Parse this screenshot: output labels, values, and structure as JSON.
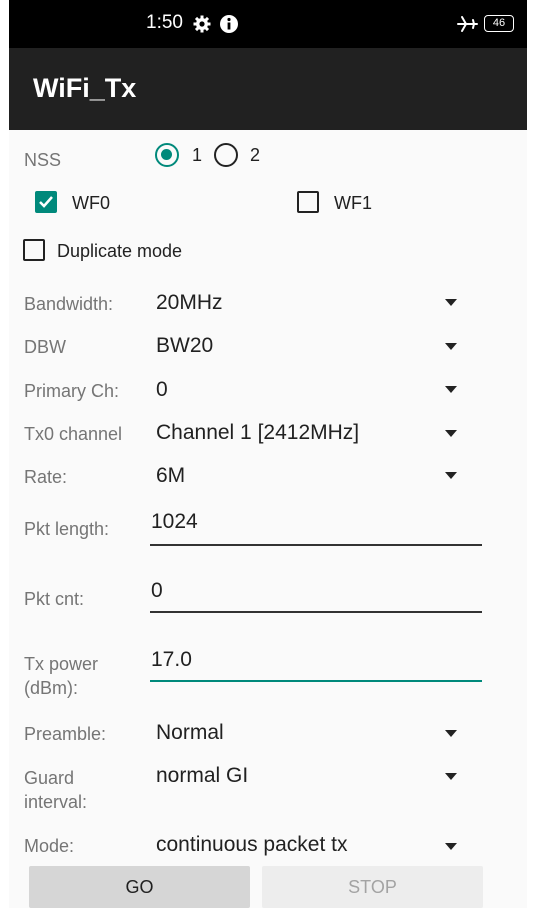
{
  "status": {
    "time": "1:50",
    "battery": "46",
    "icons": [
      "gear-icon",
      "info-icon",
      "airplane-icon",
      "battery-icon"
    ]
  },
  "appbar": {
    "title": "WiFi_Tx"
  },
  "nss": {
    "label": "NSS",
    "options": [
      "1",
      "2"
    ],
    "selected": "1"
  },
  "wf": {
    "wf0": {
      "label": "WF0",
      "checked": true
    },
    "wf1": {
      "label": "WF1",
      "checked": false
    }
  },
  "duplicate": {
    "label": "Duplicate mode",
    "checked": false
  },
  "fields": {
    "bandwidth": {
      "label": "Bandwidth:",
      "value": "20MHz"
    },
    "dbw": {
      "label": "DBW",
      "value": "BW20"
    },
    "primary": {
      "label": "Primary Ch:",
      "value": "0"
    },
    "tx0": {
      "label": "Tx0 channel",
      "value": "Channel 1 [2412MHz]"
    },
    "rate": {
      "label": "Rate:",
      "value": "6M"
    },
    "pktlen": {
      "label": "Pkt length:",
      "value": "1024"
    },
    "pktcnt": {
      "label": "Pkt cnt:",
      "value": "0"
    },
    "txpower": {
      "label1": "Tx power",
      "label2": "(dBm):",
      "value": "17.0"
    },
    "preamble": {
      "label": "Preamble:",
      "value": "Normal"
    },
    "guard": {
      "label1": "Guard",
      "label2": "interval:",
      "value": "normal GI"
    },
    "mode": {
      "label": "Mode:",
      "value": "continuous packet tx"
    }
  },
  "buttons": {
    "go": "GO",
    "stop": "STOP"
  },
  "colors": {
    "accent": "#00897b",
    "appbar": "#212121",
    "statusbar": "#000000"
  }
}
